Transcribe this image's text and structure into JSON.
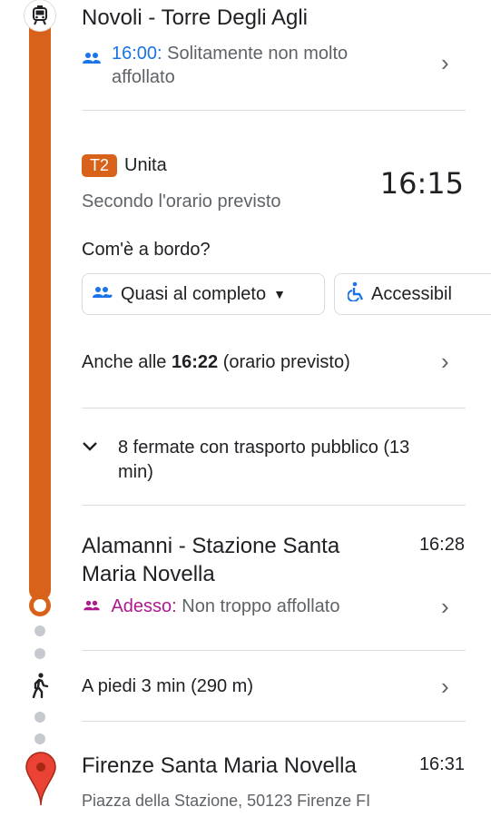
{
  "colors": {
    "route": "#D8621A",
    "link_blue": "#1a73e8",
    "live_magenta": "#b0188e"
  },
  "first_stop": {
    "name": "Novoli - Torre Degli Agli",
    "crowd_time": "16:00:",
    "crowd_text_line1": "Solitamente non molto",
    "crowd_text_line2": "affollato"
  },
  "ride": {
    "line_badge": "T2",
    "line_name": "Unita",
    "schedule_note": "Secondo l'orario previsto",
    "depart_time": "16:15",
    "onboard_question": "Com'è a bordo?",
    "chips": [
      "Quasi al completo",
      "Accessibil"
    ],
    "also_at_prefix": "Anche alle",
    "also_at_time": "16:22",
    "also_at_suffix": "(orario previsto)",
    "stops_line1": "8 fermate con trasporto pubblico (13",
    "stops_line2": "min)"
  },
  "alight_stop": {
    "name_line1": "Alamanni - Stazione Santa",
    "name_line2": "Maria Novella",
    "time": "16:28",
    "live_label": "Adesso:",
    "live_text": "Non troppo affollato"
  },
  "walk": {
    "text": "A piedi 3 min (290 m)"
  },
  "destination": {
    "name": "Firenze Santa Maria Novella",
    "time": "16:31",
    "address": "Piazza della Stazione, 50123 Firenze FI"
  },
  "icons": [
    "tram-icon",
    "people-icon",
    "chevron-right-icon",
    "dropdown-arrow-icon",
    "accessibility-icon",
    "chevron-down-icon",
    "walking-icon",
    "location-pin-icon"
  ]
}
